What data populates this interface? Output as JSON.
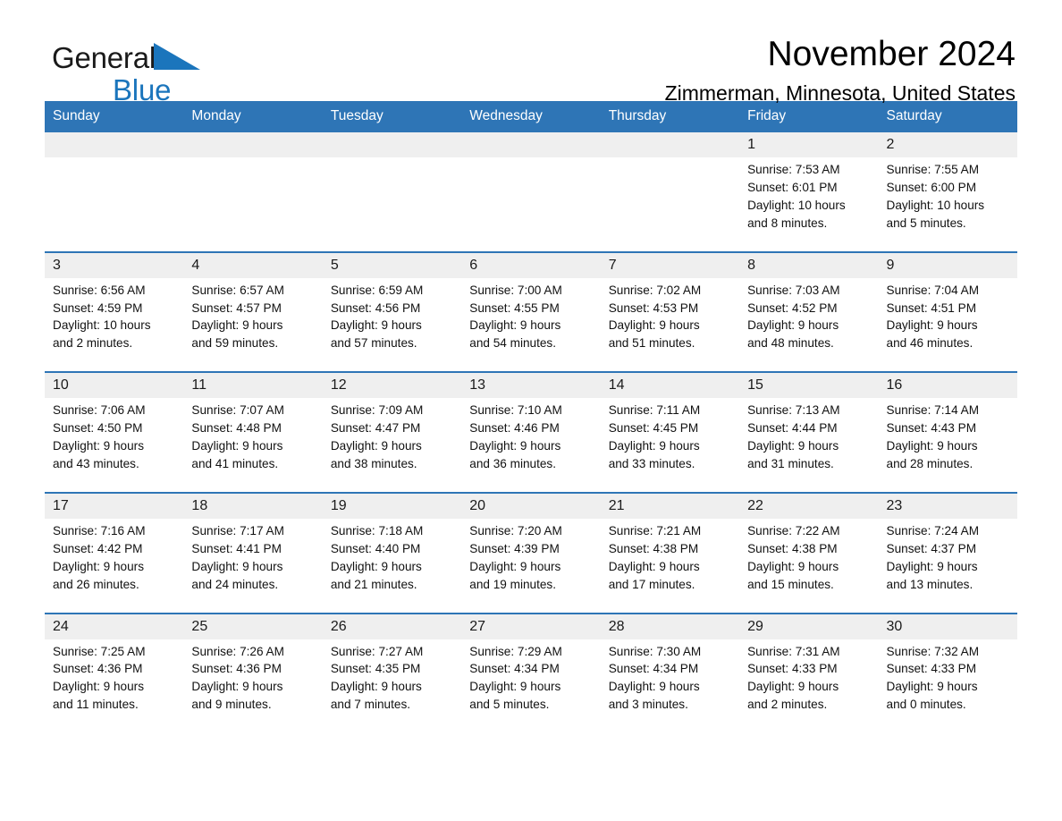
{
  "brand": {
    "word1": "General",
    "word2": "Blue",
    "triangle_color": "#1b75bc",
    "word2_color": "#1b75bc"
  },
  "header": {
    "title": "November 2024",
    "subtitle": "Zimmerman, Minnesota, United States"
  },
  "theme": {
    "header_blue": "#2e75b6",
    "daynum_band": "#efefef",
    "text": "#111111"
  },
  "weekday_headers": [
    "Sunday",
    "Monday",
    "Tuesday",
    "Wednesday",
    "Thursday",
    "Friday",
    "Saturday"
  ],
  "labels": {
    "sunrise_prefix": "Sunrise:",
    "sunset_prefix": "Sunset:",
    "daylight_prefix": "Daylight:"
  },
  "weeks": [
    {
      "days": [
        {
          "num": "",
          "l1": "",
          "l2": "",
          "l3": "",
          "l4": ""
        },
        {
          "num": "",
          "l1": "",
          "l2": "",
          "l3": "",
          "l4": ""
        },
        {
          "num": "",
          "l1": "",
          "l2": "",
          "l3": "",
          "l4": ""
        },
        {
          "num": "",
          "l1": "",
          "l2": "",
          "l3": "",
          "l4": ""
        },
        {
          "num": "",
          "l1": "",
          "l2": "",
          "l3": "",
          "l4": ""
        },
        {
          "num": "1",
          "l1": "Sunrise: 7:53 AM",
          "l2": "Sunset: 6:01 PM",
          "l3": "Daylight: 10 hours",
          "l4": "and 8 minutes."
        },
        {
          "num": "2",
          "l1": "Sunrise: 7:55 AM",
          "l2": "Sunset: 6:00 PM",
          "l3": "Daylight: 10 hours",
          "l4": "and 5 minutes."
        }
      ]
    },
    {
      "days": [
        {
          "num": "3",
          "l1": "Sunrise: 6:56 AM",
          "l2": "Sunset: 4:59 PM",
          "l3": "Daylight: 10 hours",
          "l4": "and 2 minutes."
        },
        {
          "num": "4",
          "l1": "Sunrise: 6:57 AM",
          "l2": "Sunset: 4:57 PM",
          "l3": "Daylight: 9 hours",
          "l4": "and 59 minutes."
        },
        {
          "num": "5",
          "l1": "Sunrise: 6:59 AM",
          "l2": "Sunset: 4:56 PM",
          "l3": "Daylight: 9 hours",
          "l4": "and 57 minutes."
        },
        {
          "num": "6",
          "l1": "Sunrise: 7:00 AM",
          "l2": "Sunset: 4:55 PM",
          "l3": "Daylight: 9 hours",
          "l4": "and 54 minutes."
        },
        {
          "num": "7",
          "l1": "Sunrise: 7:02 AM",
          "l2": "Sunset: 4:53 PM",
          "l3": "Daylight: 9 hours",
          "l4": "and 51 minutes."
        },
        {
          "num": "8",
          "l1": "Sunrise: 7:03 AM",
          "l2": "Sunset: 4:52 PM",
          "l3": "Daylight: 9 hours",
          "l4": "and 48 minutes."
        },
        {
          "num": "9",
          "l1": "Sunrise: 7:04 AM",
          "l2": "Sunset: 4:51 PM",
          "l3": "Daylight: 9 hours",
          "l4": "and 46 minutes."
        }
      ]
    },
    {
      "days": [
        {
          "num": "10",
          "l1": "Sunrise: 7:06 AM",
          "l2": "Sunset: 4:50 PM",
          "l3": "Daylight: 9 hours",
          "l4": "and 43 minutes."
        },
        {
          "num": "11",
          "l1": "Sunrise: 7:07 AM",
          "l2": "Sunset: 4:48 PM",
          "l3": "Daylight: 9 hours",
          "l4": "and 41 minutes."
        },
        {
          "num": "12",
          "l1": "Sunrise: 7:09 AM",
          "l2": "Sunset: 4:47 PM",
          "l3": "Daylight: 9 hours",
          "l4": "and 38 minutes."
        },
        {
          "num": "13",
          "l1": "Sunrise: 7:10 AM",
          "l2": "Sunset: 4:46 PM",
          "l3": "Daylight: 9 hours",
          "l4": "and 36 minutes."
        },
        {
          "num": "14",
          "l1": "Sunrise: 7:11 AM",
          "l2": "Sunset: 4:45 PM",
          "l3": "Daylight: 9 hours",
          "l4": "and 33 minutes."
        },
        {
          "num": "15",
          "l1": "Sunrise: 7:13 AM",
          "l2": "Sunset: 4:44 PM",
          "l3": "Daylight: 9 hours",
          "l4": "and 31 minutes."
        },
        {
          "num": "16",
          "l1": "Sunrise: 7:14 AM",
          "l2": "Sunset: 4:43 PM",
          "l3": "Daylight: 9 hours",
          "l4": "and 28 minutes."
        }
      ]
    },
    {
      "days": [
        {
          "num": "17",
          "l1": "Sunrise: 7:16 AM",
          "l2": "Sunset: 4:42 PM",
          "l3": "Daylight: 9 hours",
          "l4": "and 26 minutes."
        },
        {
          "num": "18",
          "l1": "Sunrise: 7:17 AM",
          "l2": "Sunset: 4:41 PM",
          "l3": "Daylight: 9 hours",
          "l4": "and 24 minutes."
        },
        {
          "num": "19",
          "l1": "Sunrise: 7:18 AM",
          "l2": "Sunset: 4:40 PM",
          "l3": "Daylight: 9 hours",
          "l4": "and 21 minutes."
        },
        {
          "num": "20",
          "l1": "Sunrise: 7:20 AM",
          "l2": "Sunset: 4:39 PM",
          "l3": "Daylight: 9 hours",
          "l4": "and 19 minutes."
        },
        {
          "num": "21",
          "l1": "Sunrise: 7:21 AM",
          "l2": "Sunset: 4:38 PM",
          "l3": "Daylight: 9 hours",
          "l4": "and 17 minutes."
        },
        {
          "num": "22",
          "l1": "Sunrise: 7:22 AM",
          "l2": "Sunset: 4:38 PM",
          "l3": "Daylight: 9 hours",
          "l4": "and 15 minutes."
        },
        {
          "num": "23",
          "l1": "Sunrise: 7:24 AM",
          "l2": "Sunset: 4:37 PM",
          "l3": "Daylight: 9 hours",
          "l4": "and 13 minutes."
        }
      ]
    },
    {
      "days": [
        {
          "num": "24",
          "l1": "Sunrise: 7:25 AM",
          "l2": "Sunset: 4:36 PM",
          "l3": "Daylight: 9 hours",
          "l4": "and 11 minutes."
        },
        {
          "num": "25",
          "l1": "Sunrise: 7:26 AM",
          "l2": "Sunset: 4:36 PM",
          "l3": "Daylight: 9 hours",
          "l4": "and 9 minutes."
        },
        {
          "num": "26",
          "l1": "Sunrise: 7:27 AM",
          "l2": "Sunset: 4:35 PM",
          "l3": "Daylight: 9 hours",
          "l4": "and 7 minutes."
        },
        {
          "num": "27",
          "l1": "Sunrise: 7:29 AM",
          "l2": "Sunset: 4:34 PM",
          "l3": "Daylight: 9 hours",
          "l4": "and 5 minutes."
        },
        {
          "num": "28",
          "l1": "Sunrise: 7:30 AM",
          "l2": "Sunset: 4:34 PM",
          "l3": "Daylight: 9 hours",
          "l4": "and 3 minutes."
        },
        {
          "num": "29",
          "l1": "Sunrise: 7:31 AM",
          "l2": "Sunset: 4:33 PM",
          "l3": "Daylight: 9 hours",
          "l4": "and 2 minutes."
        },
        {
          "num": "30",
          "l1": "Sunrise: 7:32 AM",
          "l2": "Sunset: 4:33 PM",
          "l3": "Daylight: 9 hours",
          "l4": "and 0 minutes."
        }
      ]
    }
  ]
}
